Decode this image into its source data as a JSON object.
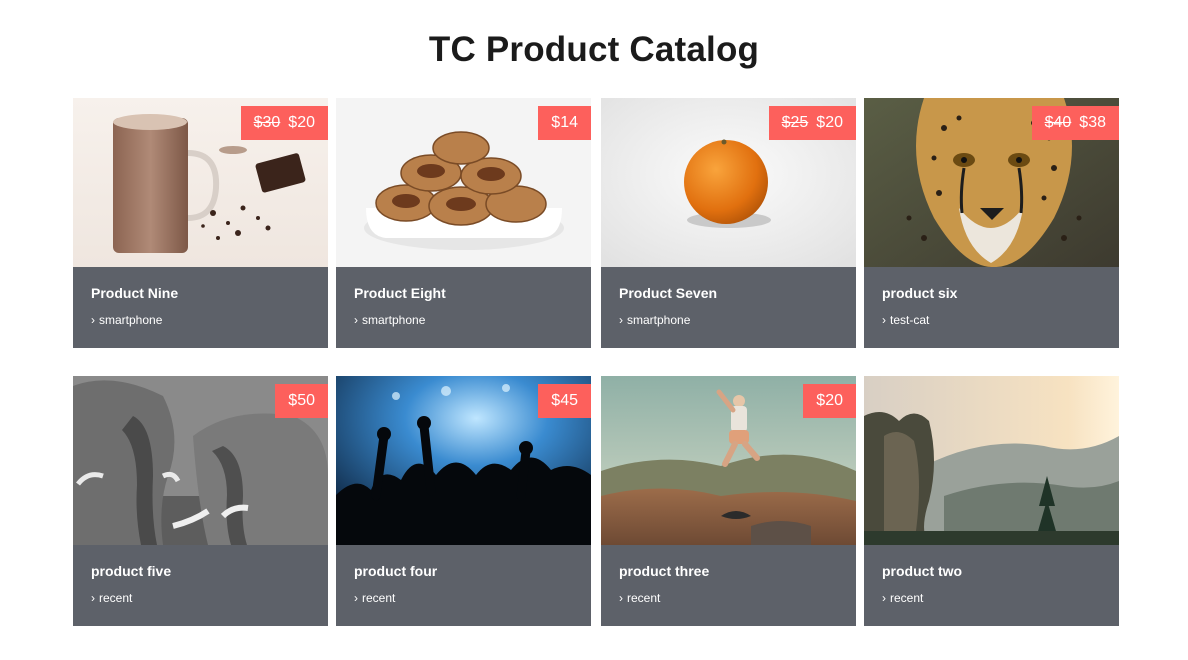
{
  "page": {
    "title": "TC Product Catalog"
  },
  "products": [
    {
      "name": "Product Nine",
      "category": "smartphone",
      "old_price": "$30",
      "price": "$20",
      "image": "hot-chocolate"
    },
    {
      "name": "Product Eight",
      "category": "smartphone",
      "old_price": "",
      "price": "$14",
      "image": "pecans"
    },
    {
      "name": "Product Seven",
      "category": "smartphone",
      "old_price": "$25",
      "price": "$20",
      "image": "orange"
    },
    {
      "name": "product six",
      "category": "test-cat",
      "old_price": "$40",
      "price": "$38",
      "image": "cheetah"
    },
    {
      "name": "product five",
      "category": "recent",
      "old_price": "",
      "price": "$50",
      "image": "elephants"
    },
    {
      "name": "product four",
      "category": "recent",
      "old_price": "",
      "price": "$45",
      "image": "concert"
    },
    {
      "name": "product three",
      "category": "recent",
      "old_price": "",
      "price": "$20",
      "image": "jumper"
    },
    {
      "name": "product two",
      "category": "recent",
      "old_price": "",
      "price": "",
      "image": "mountains"
    }
  ],
  "icons": {
    "category": "chevron-right-icon"
  },
  "colors": {
    "badge": "#fd605c",
    "info_panel": "#5d6169",
    "title": "#1b1b1b"
  }
}
